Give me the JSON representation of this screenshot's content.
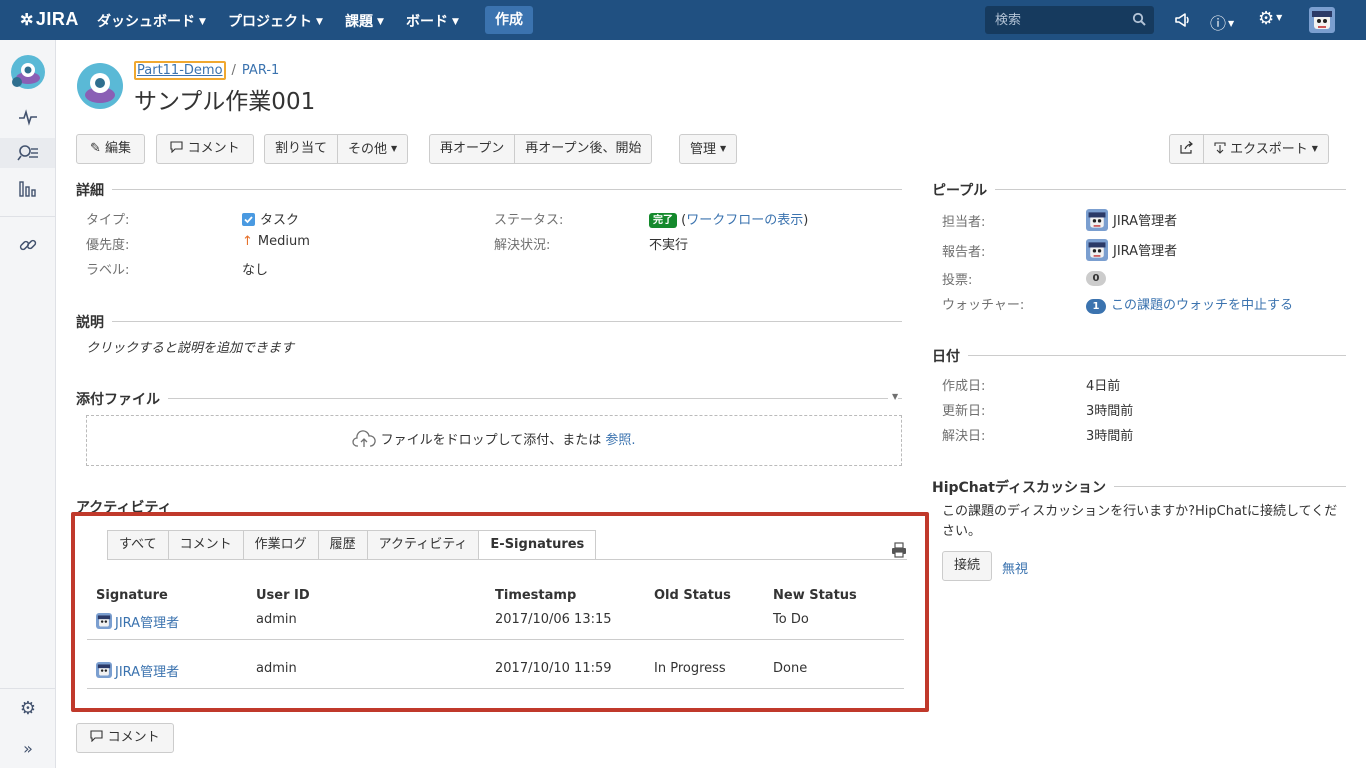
{
  "topnav": {
    "logo": "JIRA",
    "items": [
      "ダッシュボード",
      "プロジェクト",
      "課題",
      "ボード"
    ],
    "create": "作成",
    "search_placeholder": "検索"
  },
  "breadcrumb": {
    "project": "Part11-Demo",
    "issue_key": "PAR-1"
  },
  "issue": {
    "title": "サンプル作業001"
  },
  "toolbar": {
    "edit": "編集",
    "comment": "コメント",
    "assign": "割り当て",
    "more": "その他",
    "reopen": "再オープン",
    "reopen_start": "再オープン後、開始",
    "admin": "管理",
    "export": "エクスポート"
  },
  "details": {
    "heading": "詳細",
    "type_label": "タイプ:",
    "type_value": "タスク",
    "priority_label": "優先度:",
    "priority_value": "Medium",
    "labels_label": "ラベル:",
    "labels_value": "なし",
    "status_label": "ステータス:",
    "status_value": "完了",
    "workflow_link": "ワークフローの表示",
    "resolution_label": "解決状況:",
    "resolution_value": "不実行"
  },
  "description": {
    "heading": "説明",
    "placeholder": "クリックすると説明を追加できます"
  },
  "attachments": {
    "heading": "添付ファイル",
    "drop_text": "ファイルをドロップして添付、または",
    "browse": "参照."
  },
  "activity": {
    "heading": "アクティビティ",
    "tabs": [
      "すべて",
      "コメント",
      "作業ログ",
      "履歴",
      "アクティビティ",
      "E-Signatures"
    ],
    "columns": [
      "Signature",
      "User ID",
      "Timestamp",
      "Old Status",
      "New Status"
    ],
    "rows": [
      {
        "signature": "JIRA管理者",
        "user_id": "admin",
        "timestamp": "2017/10/06 13:15",
        "old_status": "",
        "new_status": "To Do"
      },
      {
        "signature": "JIRA管理者",
        "user_id": "admin",
        "timestamp": "2017/10/10 11:59",
        "old_status": "In Progress",
        "new_status": "Done"
      }
    ]
  },
  "bottom_comment": "コメント",
  "people": {
    "heading": "ピープル",
    "assignee_label": "担当者:",
    "assignee": "JIRA管理者",
    "reporter_label": "報告者:",
    "reporter": "JIRA管理者",
    "votes_label": "投票:",
    "votes": "0",
    "watchers_label": "ウォッチャー:",
    "watchers": "1",
    "watch_link": "この課題のウォッチを中止する"
  },
  "dates": {
    "heading": "日付",
    "created_label": "作成日:",
    "created": "4日前",
    "updated_label": "更新日:",
    "updated": "3時間前",
    "resolved_label": "解決日:",
    "resolved": "3時間前"
  },
  "hipchat": {
    "heading": "HipChatディスカッション",
    "text": "この課題のディスカッションを行いますか?HipChatに接続してください。",
    "connect": "接続",
    "dismiss": "無視"
  },
  "colors": {
    "header": "#205081",
    "link": "#3b73af",
    "done": "#14892c",
    "highlight": "#c0392b"
  }
}
